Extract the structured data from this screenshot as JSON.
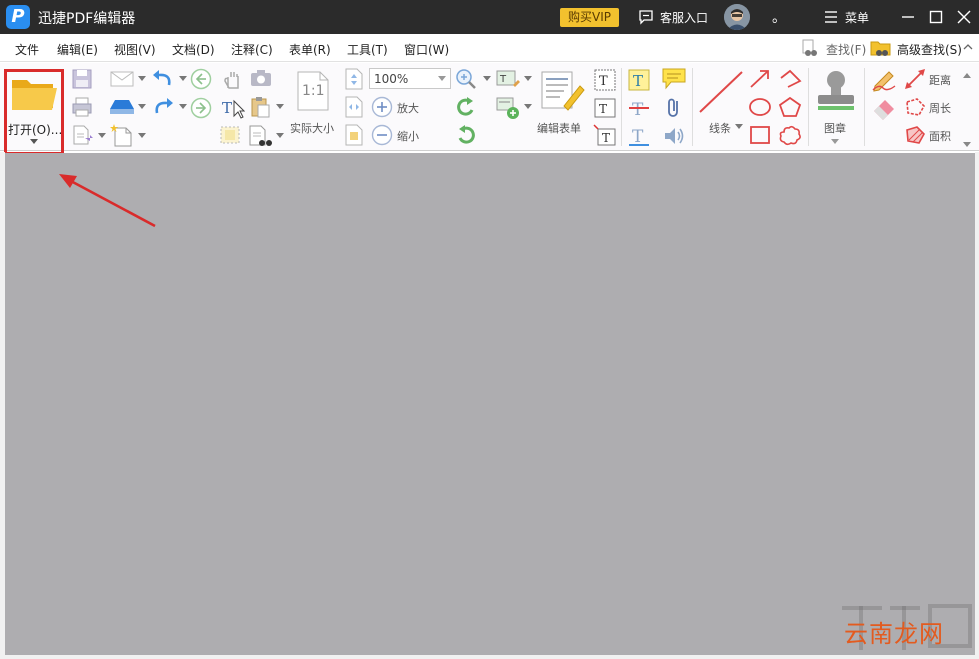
{
  "titlebar": {
    "app_title": "迅捷PDF编辑器",
    "logo_letter": "P",
    "vip_label": "购买VIP",
    "service_label": "客服入口",
    "user_dot": "。",
    "menu_label": "菜单"
  },
  "menubar": {
    "items": [
      "文件",
      "编辑(E)",
      "视图(V)",
      "文档(D)",
      "注释(C)",
      "表单(R)",
      "工具(T)",
      "窗口(W)"
    ],
    "find_label": "查找(F)",
    "advanced_find_label": "高级查找(S)"
  },
  "toolbar": {
    "open_label": "打开(O)...",
    "actual_size_label": "实际大小",
    "zoom_value": "100%",
    "zoom_in_label": "放大",
    "zoom_out_label": "缩小",
    "edit_form_label": "编辑表单",
    "lines_label": "线条",
    "stamp_label": "图章",
    "distance_label": "距离",
    "perimeter_label": "周长",
    "area_label": "面积",
    "actual_size_icon_text": "1:1"
  },
  "watermark": {
    "text": "云南龙网"
  },
  "colors": {
    "titlebar": "#2b2b2b",
    "vip": "#f2c12e",
    "highlight": "#d92b2b",
    "doc_background": "#aeadb0",
    "accent_blue": "#2a8ef0"
  }
}
